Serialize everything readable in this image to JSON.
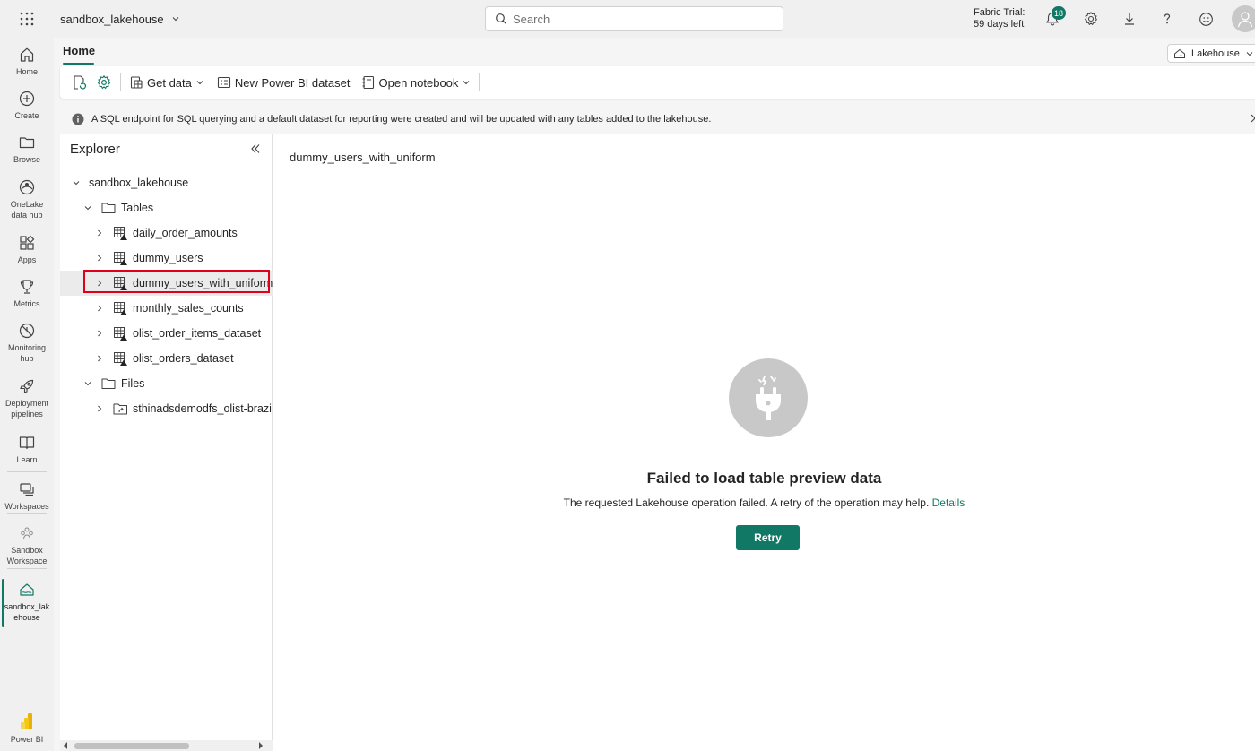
{
  "topbar": {
    "workspace_name": "sandbox_lakehouse",
    "search_placeholder": "Search",
    "trial_line1": "Fabric Trial:",
    "trial_line2": "59 days left",
    "notification_count": "18"
  },
  "rail": {
    "items": [
      {
        "label": "Home",
        "icon": "home-icon"
      },
      {
        "label": "Create",
        "icon": "create-icon"
      },
      {
        "label": "Browse",
        "icon": "browse-icon"
      },
      {
        "label": "OneLake data hub",
        "icon": "onelake-icon"
      },
      {
        "label": "Apps",
        "icon": "apps-icon"
      },
      {
        "label": "Metrics",
        "icon": "metrics-icon"
      },
      {
        "label": "Monitoring hub",
        "icon": "monitoring-icon"
      },
      {
        "label": "Deployment pipelines",
        "icon": "deployment-icon"
      },
      {
        "label": "Learn",
        "icon": "learn-icon"
      },
      {
        "label": "Workspaces",
        "icon": "workspaces-icon"
      },
      {
        "label": "Sandbox Workspace",
        "icon": "sandbox-workspace-icon"
      },
      {
        "label": "sandbox_lakehouse",
        "icon": "lakehouse-icon"
      },
      {
        "label": "Power BI",
        "icon": "powerbi-icon"
      }
    ]
  },
  "ribbon": {
    "home_tab": "Home",
    "item_type": "Lakehouse",
    "get_data": "Get data",
    "new_dataset": "New Power BI dataset",
    "open_notebook": "Open notebook"
  },
  "info": {
    "message": "A SQL endpoint for SQL querying and a default dataset for reporting were created and will be updated with any tables added to the lakehouse."
  },
  "explorer": {
    "title": "Explorer",
    "root": "sandbox_lakehouse",
    "tables_folder": "Tables",
    "tables": [
      "daily_order_amounts",
      "dummy_users",
      "dummy_users_with_uniform",
      "monthly_sales_counts",
      "olist_order_items_dataset",
      "olist_orders_dataset"
    ],
    "files_folder": "Files",
    "files": [
      "sthinadsdemodfs_olist-brazi"
    ]
  },
  "preview": {
    "table_name": "dummy_users_with_uniform",
    "error_title": "Failed to load table preview data",
    "error_message": "The requested Lakehouse operation failed. A retry of the operation may help.",
    "details_link": "Details",
    "retry_label": "Retry"
  },
  "colors": {
    "accent": "#117865",
    "highlight": "#e0001b"
  }
}
